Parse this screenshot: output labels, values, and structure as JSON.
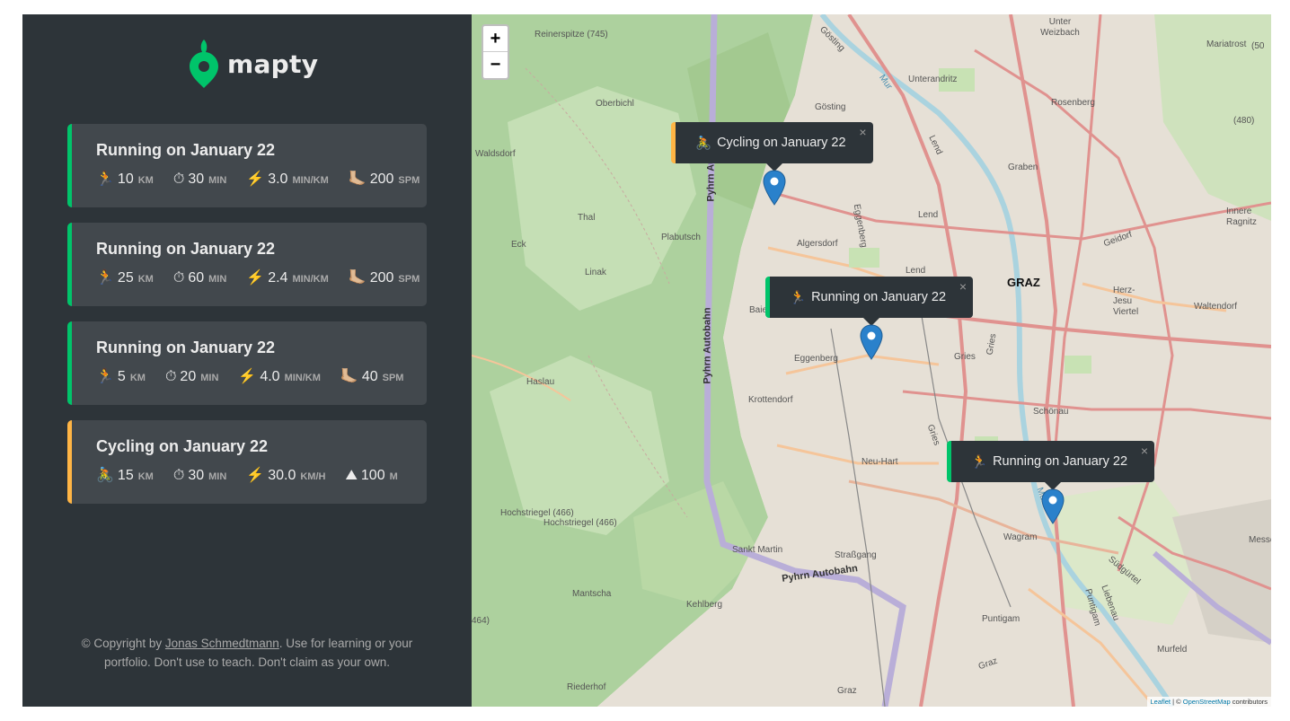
{
  "app": {
    "name": "mapty"
  },
  "workouts": [
    {
      "type": "running",
      "title": "Running on January 22",
      "stats": [
        {
          "icon": "🏃",
          "value": "10",
          "unit": "KM"
        },
        {
          "icon": "⏱",
          "value": "30",
          "unit": "MIN"
        },
        {
          "icon": "⚡️",
          "value": "3.0",
          "unit": "MIN/KM"
        },
        {
          "icon": "🦶🏼",
          "value": "200",
          "unit": "SPM"
        }
      ]
    },
    {
      "type": "running",
      "title": "Running on January 22",
      "stats": [
        {
          "icon": "🏃",
          "value": "25",
          "unit": "KM"
        },
        {
          "icon": "⏱",
          "value": "60",
          "unit": "MIN"
        },
        {
          "icon": "⚡️",
          "value": "2.4",
          "unit": "MIN/KM"
        },
        {
          "icon": "🦶🏼",
          "value": "200",
          "unit": "SPM"
        }
      ]
    },
    {
      "type": "running",
      "title": "Running on January 22",
      "stats": [
        {
          "icon": "🏃",
          "value": "5",
          "unit": "KM"
        },
        {
          "icon": "⏱",
          "value": "20",
          "unit": "MIN"
        },
        {
          "icon": "⚡️",
          "value": "4.0",
          "unit": "MIN/KM"
        },
        {
          "icon": "🦶🏼",
          "value": "40",
          "unit": "SPM"
        }
      ]
    },
    {
      "type": "cycling",
      "title": "Cycling on January 22",
      "stats": [
        {
          "icon": "🚴",
          "value": "15",
          "unit": "KM"
        },
        {
          "icon": "⏱",
          "value": "30",
          "unit": "MIN"
        },
        {
          "icon": "⚡️",
          "value": "30.0",
          "unit": "KM/H"
        },
        {
          "icon": "⛰",
          "value": "100",
          "unit": "M"
        }
      ]
    }
  ],
  "copyright": {
    "prefix": "© Copyright by ",
    "author": "Jonas Schmedtmann",
    "suffix": ". Use for learning or your portfolio. Don't use to teach. Don't claim as your own."
  },
  "map": {
    "zoom_in": "+",
    "zoom_out": "−",
    "popups": [
      {
        "type": "cycling",
        "icon": "🚴",
        "label": "Cycling on January 22",
        "close": "×"
      },
      {
        "type": "running",
        "icon": "🏃",
        "label": "Running on January 22",
        "close": "×"
      },
      {
        "type": "running",
        "icon": "🏃",
        "label": "Running on January 22",
        "close": "×"
      }
    ],
    "labels": {
      "graz": "GRAZ",
      "pyhrn1": "Pyhrn Autobahn",
      "pyhrn2": "Pyhrn Autobahn",
      "pyhrn3": "Pyhrn Autobahn",
      "reinerspitze": "Reinerspitze (745)",
      "waldsdorf": "Waldsdorf",
      "oberbichl": "Oberbichl",
      "thal": "Thal",
      "eck": "Eck",
      "linak": "Linak",
      "plabutsch": "Plabutsch",
      "haslau": "Haslau",
      "algersdorf": "Algersdorf",
      "eggenberg": "Eggenberg",
      "eggenberg2": "Eggenberg",
      "krottendorf": "Krottendorf",
      "gosting": "Gösting",
      "gosting2": "Gösting",
      "unterandritz": "Unterandritz",
      "rosenberg": "Rosenberg",
      "mariatrost": "Mariatrost",
      "unterweizbach": "Unter Weizbach",
      "graben": "Graben",
      "lend": "Lend",
      "lend2": "Lend",
      "lend3": "Lend",
      "geidorf": "Geidorf",
      "innereragnitz": "Innere Ragnitz",
      "herzjesu": "Herz-Jesu Viertel",
      "waltendorf": "Waltendorf",
      "gries": "Gries",
      "gries2": "Gries",
      "gries3": "Gries",
      "schonau": "Schönau",
      "neuhart": "Neu-Hart",
      "wagram": "Wagram",
      "strassgang": "Straßgang",
      "sanktmartin": "Sankt Martin",
      "mantscha": "Mantscha",
      "kehlberg": "Kehlberg",
      "hochstriegel1": "Hochstriegel (466)",
      "hochstriegel2": "Hochstriegel (466)",
      "puntigam": "Puntigam",
      "puntigam2": "Puntigam",
      "murfeld": "Murfeld",
      "liebenau": "Liebenau",
      "sudgurtel": "Südgürtel",
      "messe": "Messe",
      "riederhof": "Riederhof",
      "graz2": "Graz",
      "graz3": "Graz",
      "baie": "Baie",
      "mur": "Mur",
      "mur2": "Mur",
      "n480": "(480)",
      "n50": "(50",
      "n464": "464)"
    },
    "attribution": {
      "leaflet": "Leaflet",
      "sep": " | © ",
      "osm": "OpenStreetMap",
      "suffix": " contributors"
    }
  },
  "colors": {
    "sidebar_bg": "#2d3439",
    "card_bg": "#42484d",
    "running_accent": "#00c46a",
    "cycling_accent": "#ffb545",
    "marker_blue": "#2a81cb"
  }
}
